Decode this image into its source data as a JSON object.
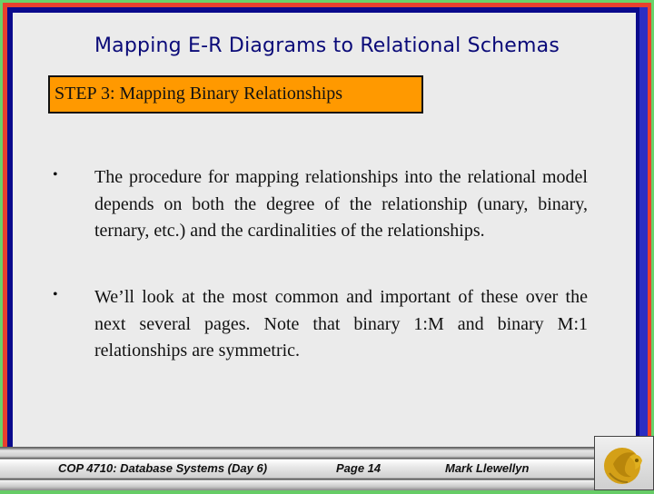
{
  "slide": {
    "title": "Mapping E-R Diagrams to Relational Schemas",
    "step_label": "STEP 3:  Mapping Binary Relationships",
    "bullets": [
      {
        "marker": "•",
        "text": "The procedure for mapping relationships into the relational model depends on both the degree of the relationship (unary, binary, ternary, etc.) and the cardinalities of the relationships."
      },
      {
        "marker": "•",
        "text": "We’ll look at the most common and important of these over the next several pages.  Note that binary 1:M and binary M:1 relationships are symmetric."
      }
    ]
  },
  "footer": {
    "course": "COP 4710: Database Systems  (Day 6)",
    "page": "Page 14",
    "author": "Mark Llewellyn",
    "logo_icon": "pegasus-logo-icon"
  },
  "colors": {
    "title_text": "#0a0a78",
    "step_box_fill": "#ff9900",
    "slide_background": "#ebebeb",
    "frame_green": "#6ad26a",
    "frame_red": "#e8412e",
    "frame_blue": "#2a2ec4",
    "frame_navy": "#0a0a8c",
    "logo_gold": "#d4a017"
  }
}
